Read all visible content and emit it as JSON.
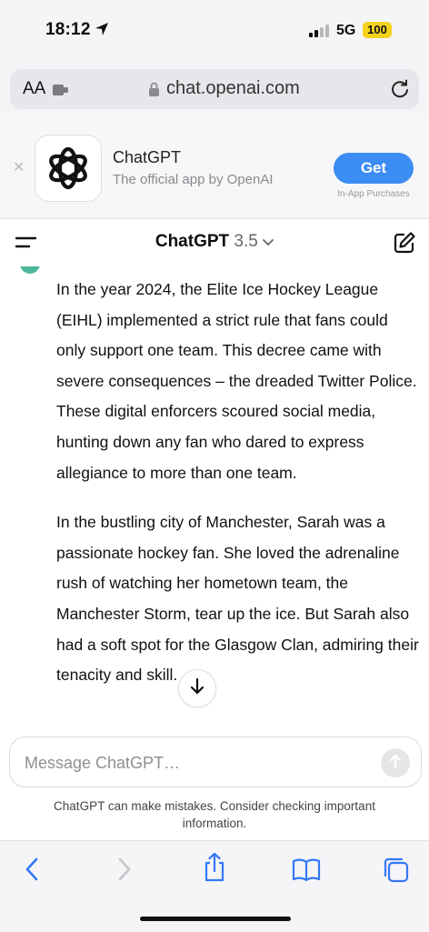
{
  "status": {
    "time": "18:12",
    "network": "5G",
    "battery": "100"
  },
  "browser": {
    "text_size": "AA",
    "url": "chat.openai.com"
  },
  "banner": {
    "app_name": "ChatGPT",
    "app_subtitle": "The official app by OpenAI",
    "get_label": "Get",
    "iap_note": "In-App Purchases"
  },
  "header": {
    "title": "ChatGPT",
    "version": "3.5"
  },
  "message": {
    "paragraphs": [
      "In the year 2024, the Elite Ice Hockey League (EIHL) implemented a strict rule that fans could only support one team. This decree came with severe consequences – the dreaded Twitter Police. These digital enforcers scoured social media, hunting down any fan who dared to express allegiance to more than one team.",
      "In the bustling city of Manchester, Sarah was a passionate hockey fan. She loved the adrenaline rush of watching her hometown team, the Manchester Storm, tear up the ice. But Sarah also had a soft spot for the Glasgow Clan, admiring their tenacity and skill."
    ]
  },
  "composer": {
    "placeholder": "Message ChatGPT…",
    "value": ""
  },
  "disclaimer": "ChatGPT can make mistakes. Consider checking important information.",
  "colors": {
    "accent": "#3b8cf3",
    "toolbar_icon": "#3478f6",
    "battery": "#f4d21d"
  },
  "icons": [
    "location-arrow-icon",
    "signal-icon",
    "extension-icon",
    "lock-icon",
    "reload-icon",
    "close-icon",
    "openai-logo-icon",
    "menu-icon",
    "chevron-down-icon",
    "edit-icon",
    "arrow-down-icon",
    "arrow-up-icon",
    "back-icon",
    "forward-icon",
    "share-icon",
    "bookmarks-icon",
    "tabs-icon"
  ]
}
